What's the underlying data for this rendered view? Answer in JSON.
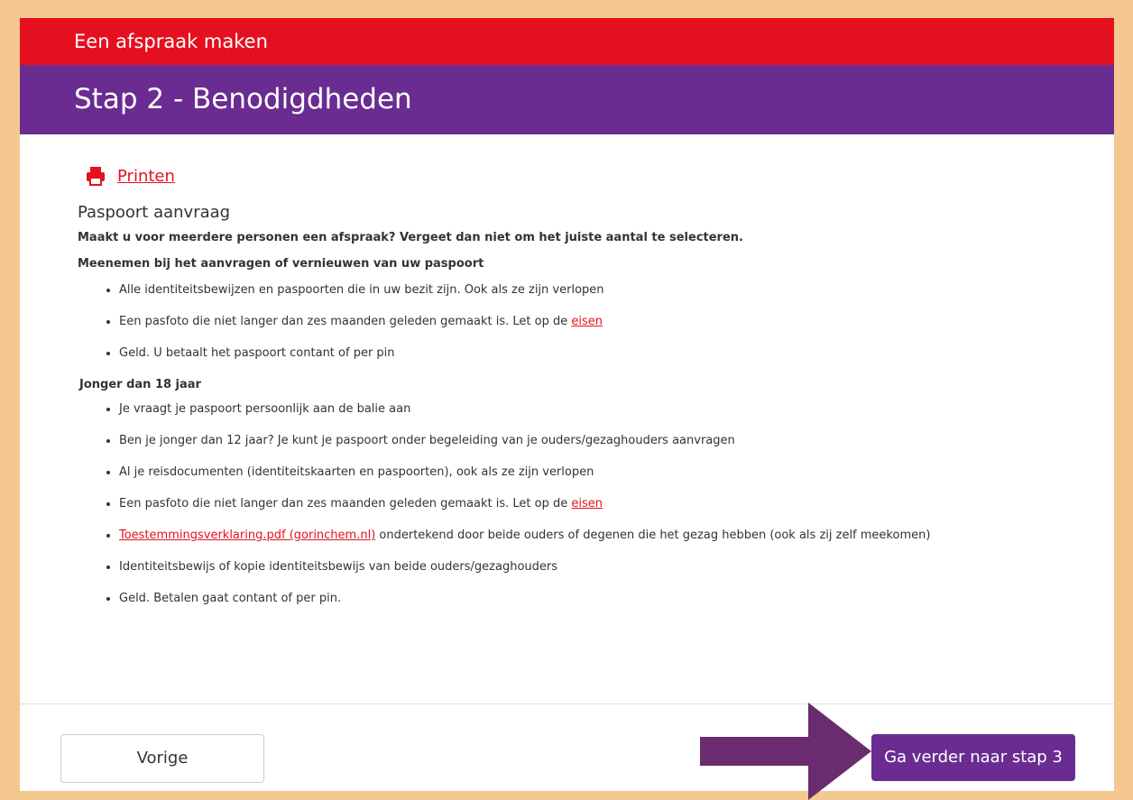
{
  "header": {
    "app_title": "Een afspraak maken",
    "step_title": "Stap 2 - Benodigdheden"
  },
  "print": {
    "label": "Printen",
    "icon": "printer-icon"
  },
  "section": {
    "title": "Paspoort aanvraag",
    "notice": "Maakt u voor meerdere personen een afspraak? Vergeet dan niet om het juiste aantal te selecteren.",
    "bring_heading": "Meenemen bij het aanvragen of vernieuwen van uw paspoort",
    "bring_items": [
      "Alle identiteitsbewijzen en paspoorten die in uw bezit zijn. Ook als ze zijn verlopen",
      "Een pasfoto die niet langer dan zes maanden geleden gemaakt is. Let op de ",
      "Geld. U betaalt het paspoort contant of per pin"
    ],
    "eisen_link": "eisen",
    "minor_heading": "Jonger dan 18 jaar",
    "minor_items": [
      "Je vraagt je paspoort persoonlijk aan de balie aan",
      "Ben je jonger dan 12 jaar? Je kunt je paspoort onder begeleiding van je ouders/gezaghouders aanvragen",
      "Al je reisdocumenten (identiteitskaarten en paspoorten), ook als ze zijn verlopen",
      "Een pasfoto die niet langer dan zes maanden geleden gemaakt is. Let op de ",
      " ondertekend door beide ouders of degenen die het gezag hebben (ook als zij zelf meekomen)",
      "Identiteitsbewijs of kopie identiteitsbewijs van beide ouders/gezaghouders",
      "Geld. Betalen gaat contant of per pin."
    ],
    "consent_link": "Toestemmingsverklaring.pdf (gorinchem.nl)"
  },
  "footer": {
    "prev_label": "Vorige",
    "next_label": "Ga verder naar stap 3"
  },
  "colors": {
    "red": "#e5101f",
    "purple": "#6a2c91",
    "border_bg": "#f4c88f",
    "arrow": "#6a2c6f"
  }
}
